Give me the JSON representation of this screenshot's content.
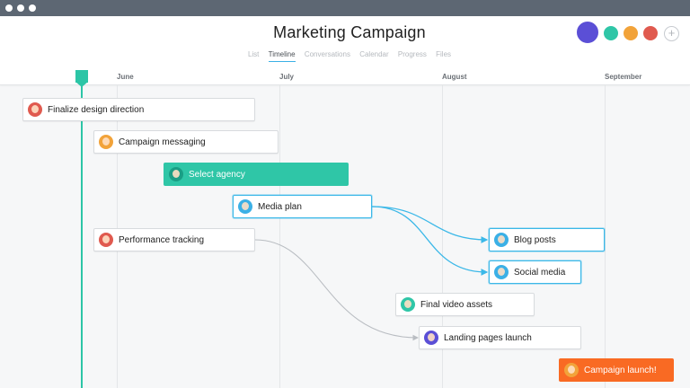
{
  "window": {
    "dots": 3
  },
  "project": {
    "title": "Marketing Campaign"
  },
  "tabs": [
    {
      "label": "List",
      "active": false
    },
    {
      "label": "Timeline",
      "active": true
    },
    {
      "label": "Conversations",
      "active": false
    },
    {
      "label": "Calendar",
      "active": false
    },
    {
      "label": "Progress",
      "active": false
    },
    {
      "label": "Files",
      "active": false
    }
  ],
  "members": {
    "avatar_colors": [
      "#5b4fd6",
      "#2fc6a7",
      "#f2a33a",
      "#e05a4f"
    ],
    "add_label": "+"
  },
  "months": [
    "June",
    "July",
    "August",
    "September"
  ],
  "tasks": [
    {
      "label": "Finalize design direction",
      "avatar_color": "#e05a4f"
    },
    {
      "label": "Campaign messaging",
      "avatar_color": "#f2a33a"
    },
    {
      "label": "Select agency",
      "avatar_color": "#1a9e85"
    },
    {
      "label": "Media plan",
      "avatar_color": "#3bb0e6"
    },
    {
      "label": "Performance tracking",
      "avatar_color": "#e05a4f"
    },
    {
      "label": "Blog posts",
      "avatar_color": "#3bb0e6"
    },
    {
      "label": "Social media",
      "avatar_color": "#3bb0e6"
    },
    {
      "label": "Final video assets",
      "avatar_color": "#2fc6a7"
    },
    {
      "label": "Landing pages launch",
      "avatar_color": "#5b4fd6"
    },
    {
      "label": "Campaign launch!",
      "avatar_color": "#f2a33a"
    }
  ],
  "colors": {
    "accent": "#3bb8e8",
    "today": "#2cc5a6",
    "dependency_gray": "#b9bdc2",
    "milestone": "#f96a23"
  }
}
